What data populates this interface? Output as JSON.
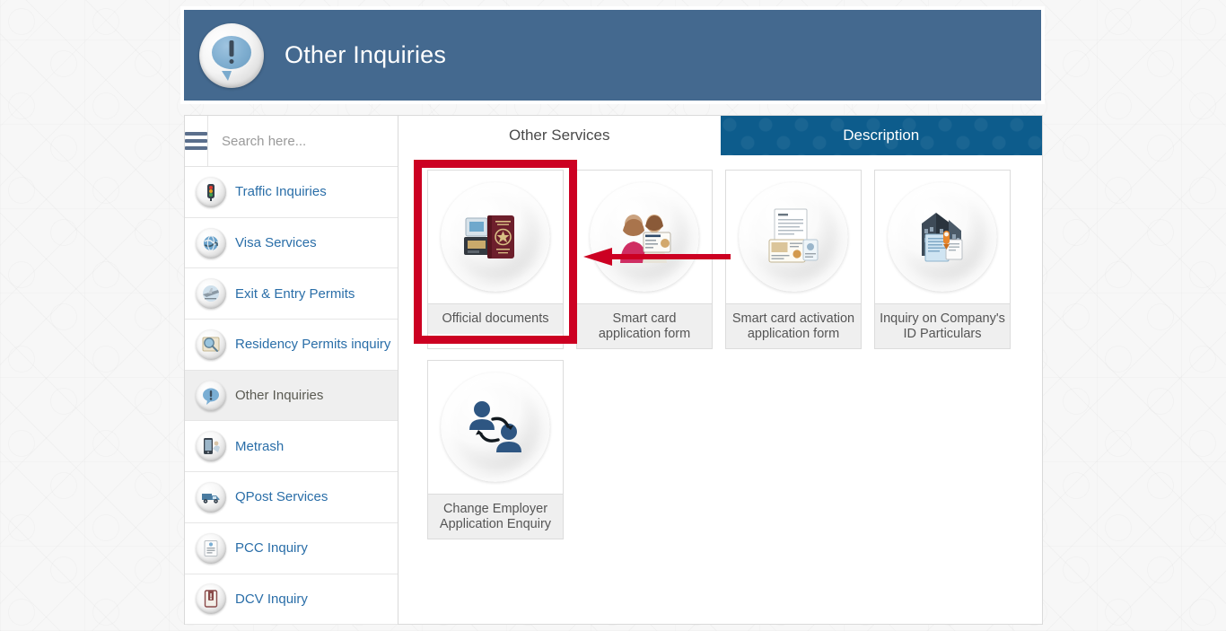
{
  "header": {
    "title": "Other Inquiries",
    "icon": "speech-bubble-exclamation-icon",
    "bg_color": "#44698f"
  },
  "sidebar": {
    "search": {
      "placeholder": "Search here...",
      "value": ""
    },
    "menu_icon": "hamburger-icon",
    "items": [
      {
        "label": "Traffic Inquiries",
        "icon": "traffic-light-icon",
        "active": false
      },
      {
        "label": "Visa Services",
        "icon": "globe-visa-icon",
        "active": false
      },
      {
        "label": "Exit & Entry Permits",
        "icon": "airplane-icon",
        "active": false
      },
      {
        "label": "Residency Permits inquiry",
        "icon": "passport-magnifier-icon",
        "active": false
      },
      {
        "label": "Other Inquiries",
        "icon": "speech-bubble-exclamation-icon",
        "active": true
      },
      {
        "label": "Metrash",
        "icon": "mobile-phone-icon",
        "active": false
      },
      {
        "label": "QPost Services",
        "icon": "delivery-van-icon",
        "active": false
      },
      {
        "label": "PCC Inquiry",
        "icon": "certificate-icon",
        "active": false
      },
      {
        "label": "DCV Inquiry",
        "icon": "document-folder-icon",
        "active": false
      }
    ],
    "link_color": "#2a6ea8",
    "active_color": "#5a5a52"
  },
  "main": {
    "tabs": [
      {
        "label": "Other Services",
        "state": "active-light"
      },
      {
        "label": "Description",
        "state": "active-dark"
      }
    ],
    "tab_dark_color": "#0d5c8c",
    "cards": [
      {
        "label": "Official documents",
        "icon": "passport-documents-icon",
        "highlighted": true
      },
      {
        "label": "Smart card\napplication form",
        "icon": "people-id-card-icon",
        "highlighted": false
      },
      {
        "label": "Smart card activation\napplication form",
        "icon": "form-document-icon",
        "highlighted": false
      },
      {
        "label": "Inquiry on Company's\nID Particulars",
        "icon": "company-certificate-icon",
        "highlighted": false
      },
      {
        "label": "Change Employer\nApplication Enquiry",
        "icon": "employer-exchange-icon",
        "highlighted": false
      }
    ]
  },
  "annotations": {
    "highlight_color": "#cc0022",
    "arrow_color": "#cc0022",
    "arrow_direction": "left",
    "highlight_target": "Official documents"
  }
}
